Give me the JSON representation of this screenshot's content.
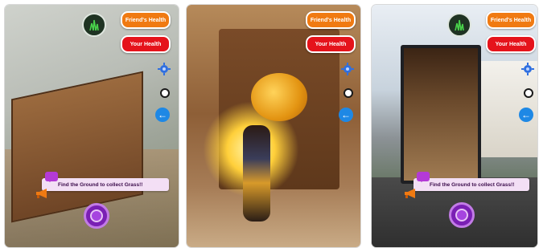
{
  "screens": [
    {
      "friends_health": "Friend's Health",
      "your_health": "Your Health",
      "banner": "Find the Ground to collect Grass!!",
      "icons": {
        "grass": "grass-icon",
        "settings": "gear-icon",
        "back": "arrow-left-icon",
        "message": "chat-icon",
        "announce": "megaphone-icon",
        "record": "record-icon"
      }
    },
    {
      "friends_health": "Friend's Health",
      "your_health": "Your Health",
      "icons": {
        "grass": "grass-icon",
        "settings": "gear-icon",
        "back": "arrow-left-icon"
      }
    },
    {
      "friends_health": "Friend's Health",
      "your_health": "Your Health",
      "banner": "Find the Ground to collect Grass!!",
      "icons": {
        "grass": "grass-icon",
        "settings": "gear-icon",
        "back": "arrow-left-icon",
        "message": "chat-icon",
        "announce": "megaphone-icon",
        "record": "record-icon"
      }
    }
  ],
  "colors": {
    "friend": "#f07a12",
    "your": "#e5131b",
    "back": "#1e88e5",
    "record": "#7a1fb4",
    "banner": "#f3dff5"
  }
}
